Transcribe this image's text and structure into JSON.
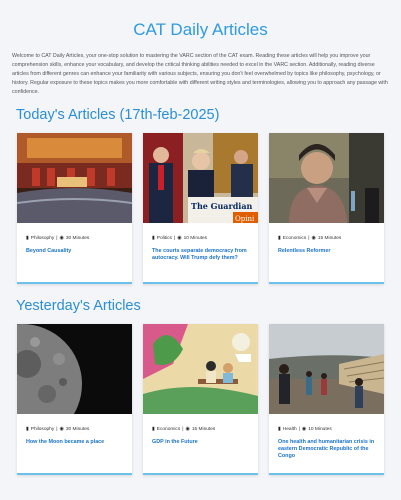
{
  "page_title": "CAT Daily Articles",
  "intro": "Welcome to CAT Daily Articles, your one-stop solution to mastering the VARC section of the CAT exam. Reading these articles will help you improve your comprehension skills, enhance your vocabulary, and develop the critical thinking abilities needed to excel in the VARC section. Additionally, reading diverse articles from different genres can enhance your familiarity with various subjects, ensuring you don't feel overwhelmed by topics like philosophy, psychology, or history. Regular exposure to these topics makes you more comfortable with different writing styles and terminologies, allowing you to approach any passage with confidence.",
  "today": {
    "heading": "Today's Articles (17th-feb-2025)",
    "articles": [
      {
        "category": "Philosophy",
        "duration": "30 Minutes",
        "title": "Beyond Causality"
      },
      {
        "category": "Politics",
        "duration": "10 Minutes",
        "title": "The courts separate democracy from autocracy. Will Trump defy them?"
      },
      {
        "category": "Economics",
        "duration": "15 Minutes",
        "title": "Relentless Reformer"
      }
    ]
  },
  "yesterday": {
    "heading": "Yesterday's Articles",
    "articles": [
      {
        "category": "Philosophy",
        "duration": "30 Minutes",
        "title": "How the Moon became a place"
      },
      {
        "category": "Economics",
        "duration": "15 Minutes",
        "title": "GDP in the Future"
      },
      {
        "category": "Health",
        "duration": "10 Minutes",
        "title": "One health and humanitarian crisis in eastern Democratic Republic of the Congo"
      }
    ]
  },
  "logo_text": "The Guardian Opinion"
}
